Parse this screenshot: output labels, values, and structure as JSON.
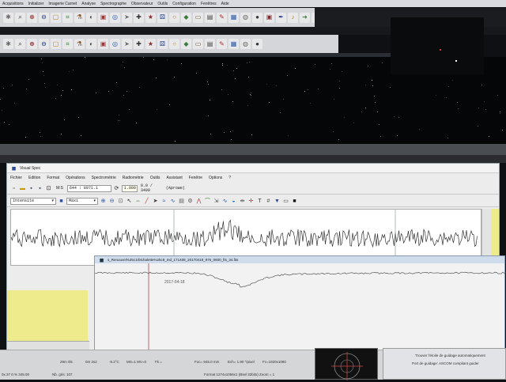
{
  "app_menu": [
    "Acquisitions",
    "Initializer",
    "Imagerie Carnet",
    "Analyse",
    "Spectrographe",
    "Observateur",
    "Outils",
    "Configuration",
    "Fenêtres",
    "Aide"
  ],
  "toolbar_icons_row1": [
    "gear-icon",
    "magnifier-icon",
    "magnifier-plus-icon",
    "magnifier-minus-icon",
    "frame-icon",
    "crop-icon",
    "flask-icon",
    "color-icon",
    "cube-icon",
    "spiral-icon",
    "cursor-icon",
    "cross-icon",
    "star-icon",
    "dice-icon",
    "ring-icon",
    "fill-icon",
    "rect-icon",
    "window-icon",
    "tool-icon",
    "grid-icon",
    "globe-icon",
    "ball-icon",
    "image-icon",
    "pen-icon",
    "bell-icon",
    "arrow-icon",
    "camera-icon",
    "flag-icon",
    "target-icon",
    "mask-icon"
  ],
  "toolbar_icons_row2": [
    "arrow-icon",
    "magnifier-icon",
    "brush-icon",
    "dot-icon",
    "text-icon",
    "globe-icon",
    "gear-icon",
    "align-icon",
    "grid-icon",
    "sun-icon",
    "ruler-icon",
    "scale-icon",
    "arrow-right-icon",
    "chart-icon",
    "move-icon",
    "star-icon",
    "checker-icon",
    "cube-icon",
    "swirl-icon",
    "paint-icon",
    "target-icon",
    "triangle-icon"
  ],
  "visual_spec": {
    "title": "Visual Spec",
    "menu": [
      "Fichier",
      "Edition",
      "Format",
      "Opérations",
      "Spectrométrie",
      "Radiométrie",
      "Outils",
      "Assistant",
      "Fenêtre",
      "Options",
      "?"
    ],
    "toolbar": {
      "field_a": "M:S",
      "field_b": "644 : 8971.1",
      "field_c": "1.000",
      "field_d": "1.0 3480",
      "field_e": "0.0 / 3490",
      "field_f": "(Aprowe)",
      "combo_left": "Intensite",
      "combo_right": "Maxi"
    },
    "subwindow": {
      "title": "s_Renouvel%25c1rbtchalette%25c9_Ind_171408_20170418_976_0600_fts_34.fits",
      "date_label": "2017-04-18"
    }
  },
  "status": {
    "cell_1": "0x.37 0.% 345.00",
    "cell_2": "Nb. gris: 107",
    "cell_3": "29m 0ls",
    "cell_4": "0m 2s2",
    "cell_5": "-5.2°C",
    "cell_6": "MS=1 MV=0",
    "cell_7": "Fk =",
    "cell_8": "Foc= 945.0 mm",
    "cell_9": "Ech= 1.90 \"/pixel",
    "cell_10": "Fc=1920x1080",
    "cell_11": "Format 1274x1056x1 (Bsel 32bits) Zoom = 1",
    "guide_1": "Trouver l'étoile de guidage automatiquement",
    "guide_2": "Port de guidage: ASCOM compliant guider"
  },
  "colors": {
    "screen_bg": "#0e1014",
    "menu_bg": "#d9dbe0",
    "window_bg": "#ececec",
    "graph_bg": "#ffffff",
    "spectrum_line": "#333333",
    "marker_line": "#b04040",
    "side_panel": "#eeeb8c",
    "subwindow_title": "#cfdcec"
  }
}
